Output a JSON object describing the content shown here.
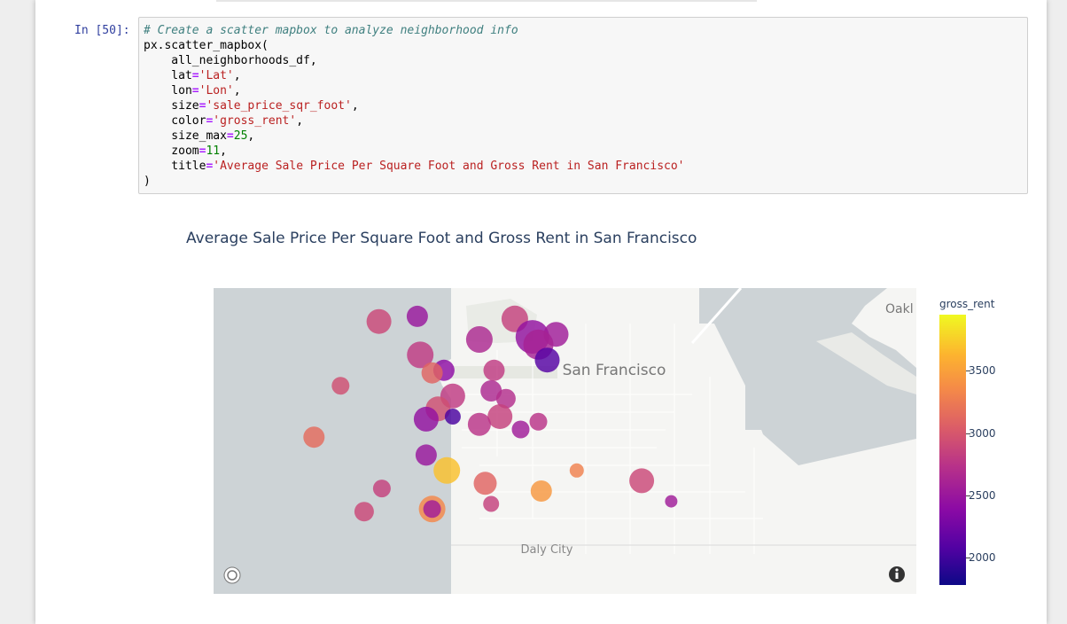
{
  "cell": {
    "prompt": "In [50]:",
    "code_lines": [
      [
        [
          "# Create a scatter mapbox to analyze neighborhood info",
          "comment"
        ]
      ],
      [
        [
          "px.scatter_mapbox(",
          ""
        ]
      ],
      [
        [
          "    all_neighborhoods_df,",
          ""
        ]
      ],
      [
        [
          "    lat",
          ""
        ],
        [
          "=",
          "op"
        ],
        [
          "'Lat'",
          "str"
        ],
        [
          ",",
          ""
        ]
      ],
      [
        [
          "    lon",
          ""
        ],
        [
          "=",
          "op"
        ],
        [
          "'Lon'",
          "str"
        ],
        [
          ",",
          ""
        ]
      ],
      [
        [
          "    size",
          ""
        ],
        [
          "=",
          "op"
        ],
        [
          "'sale_price_sqr_foot'",
          "str"
        ],
        [
          ",",
          ""
        ]
      ],
      [
        [
          "    color",
          ""
        ],
        [
          "=",
          "op"
        ],
        [
          "'gross_rent'",
          "str"
        ],
        [
          ",",
          ""
        ]
      ],
      [
        [
          "    size_max",
          ""
        ],
        [
          "=",
          "op"
        ],
        [
          "25",
          "num"
        ],
        [
          ",",
          ""
        ]
      ],
      [
        [
          "    zoom",
          ""
        ],
        [
          "=",
          "op"
        ],
        [
          "11",
          "num"
        ],
        [
          ",",
          ""
        ]
      ],
      [
        [
          "    title",
          ""
        ],
        [
          "=",
          "op"
        ],
        [
          "'Average Sale Price Per Square Foot and Gross Rent in San Francisco'",
          "str"
        ]
      ],
      [
        [
          ")",
          ""
        ]
      ]
    ]
  },
  "chart": {
    "title": "Average Sale Price Per Square Foot and Gross Rent in San Francisco",
    "map_labels": {
      "city": "San Francisco",
      "south": "Daly City",
      "northeast": "Oakl"
    },
    "colorbar": {
      "title": "gross_rent",
      "ticks": [
        "3500",
        "3000",
        "2500",
        "2000"
      ]
    },
    "icons": {
      "bottom_left": "mapbox-logo-icon",
      "bottom_right": "info-icon"
    }
  },
  "chart_data": {
    "type": "scatter",
    "title": "Average Sale Price Per Square Foot and Gross Rent in San Francisco",
    "x_field": "Lon",
    "y_field": "Lat",
    "size_field": "sale_price_sqr_foot",
    "color_field": "gross_rent",
    "color_range": [
      1780,
      3960
    ],
    "points": [
      {
        "lon": -122.462,
        "lat": 37.799,
        "rent": 2900,
        "size": 14
      },
      {
        "lon": -122.449,
        "lat": 37.801,
        "rent": 2500,
        "size": 12
      },
      {
        "lon": -122.428,
        "lat": 37.792,
        "rent": 2650,
        "size": 15
      },
      {
        "lon": -122.416,
        "lat": 37.8,
        "rent": 2850,
        "size": 15
      },
      {
        "lon": -122.41,
        "lat": 37.793,
        "rent": 2450,
        "size": 19
      },
      {
        "lon": -122.402,
        "lat": 37.794,
        "rent": 2550,
        "size": 14
      },
      {
        "lon": -122.408,
        "lat": 37.79,
        "rent": 2600,
        "size": 17
      },
      {
        "lon": -122.405,
        "lat": 37.784,
        "rent": 2100,
        "size": 14
      },
      {
        "lon": -122.448,
        "lat": 37.786,
        "rent": 2800,
        "size": 15
      },
      {
        "lon": -122.44,
        "lat": 37.78,
        "rent": 2400,
        "size": 12
      },
      {
        "lon": -122.444,
        "lat": 37.779,
        "rent": 3100,
        "size": 12
      },
      {
        "lon": -122.423,
        "lat": 37.78,
        "rent": 2800,
        "size": 12
      },
      {
        "lon": -122.475,
        "lat": 37.774,
        "rent": 2950,
        "size": 10
      },
      {
        "lon": -122.437,
        "lat": 37.77,
        "rent": 2800,
        "size": 14
      },
      {
        "lon": -122.424,
        "lat": 37.772,
        "rent": 2650,
        "size": 12
      },
      {
        "lon": -122.419,
        "lat": 37.769,
        "rent": 2700,
        "size": 11
      },
      {
        "lon": -122.442,
        "lat": 37.765,
        "rent": 2950,
        "size": 14
      },
      {
        "lon": -122.446,
        "lat": 37.761,
        "rent": 2450,
        "size": 14
      },
      {
        "lon": -122.437,
        "lat": 37.762,
        "rent": 2050,
        "size": 9
      },
      {
        "lon": -122.421,
        "lat": 37.762,
        "rent": 2850,
        "size": 14
      },
      {
        "lon": -122.428,
        "lat": 37.759,
        "rent": 2750,
        "size": 13
      },
      {
        "lon": -122.414,
        "lat": 37.757,
        "rent": 2550,
        "size": 10
      },
      {
        "lon": -122.408,
        "lat": 37.76,
        "rent": 2750,
        "size": 10
      },
      {
        "lon": -122.484,
        "lat": 37.754,
        "rent": 3150,
        "size": 12
      },
      {
        "lon": -122.446,
        "lat": 37.747,
        "rent": 2500,
        "size": 12
      },
      {
        "lon": -122.439,
        "lat": 37.741,
        "rent": 3700,
        "size": 15
      },
      {
        "lon": -122.426,
        "lat": 37.736,
        "rent": 3100,
        "size": 13
      },
      {
        "lon": -122.395,
        "lat": 37.741,
        "rent": 3300,
        "size": 8
      },
      {
        "lon": -122.373,
        "lat": 37.737,
        "rent": 2900,
        "size": 14
      },
      {
        "lon": -122.407,
        "lat": 37.733,
        "rent": 3450,
        "size": 12
      },
      {
        "lon": -122.461,
        "lat": 37.734,
        "rent": 2850,
        "size": 10
      },
      {
        "lon": -122.363,
        "lat": 37.729,
        "rent": 2550,
        "size": 7
      },
      {
        "lon": -122.424,
        "lat": 37.728,
        "rent": 2850,
        "size": 9
      },
      {
        "lon": -122.467,
        "lat": 37.725,
        "rent": 2900,
        "size": 11
      },
      {
        "lon": -122.444,
        "lat": 37.726,
        "rent": 3350,
        "size": 15
      },
      {
        "lon": -122.444,
        "lat": 37.726,
        "rent": 2550,
        "size": 10
      }
    ]
  }
}
